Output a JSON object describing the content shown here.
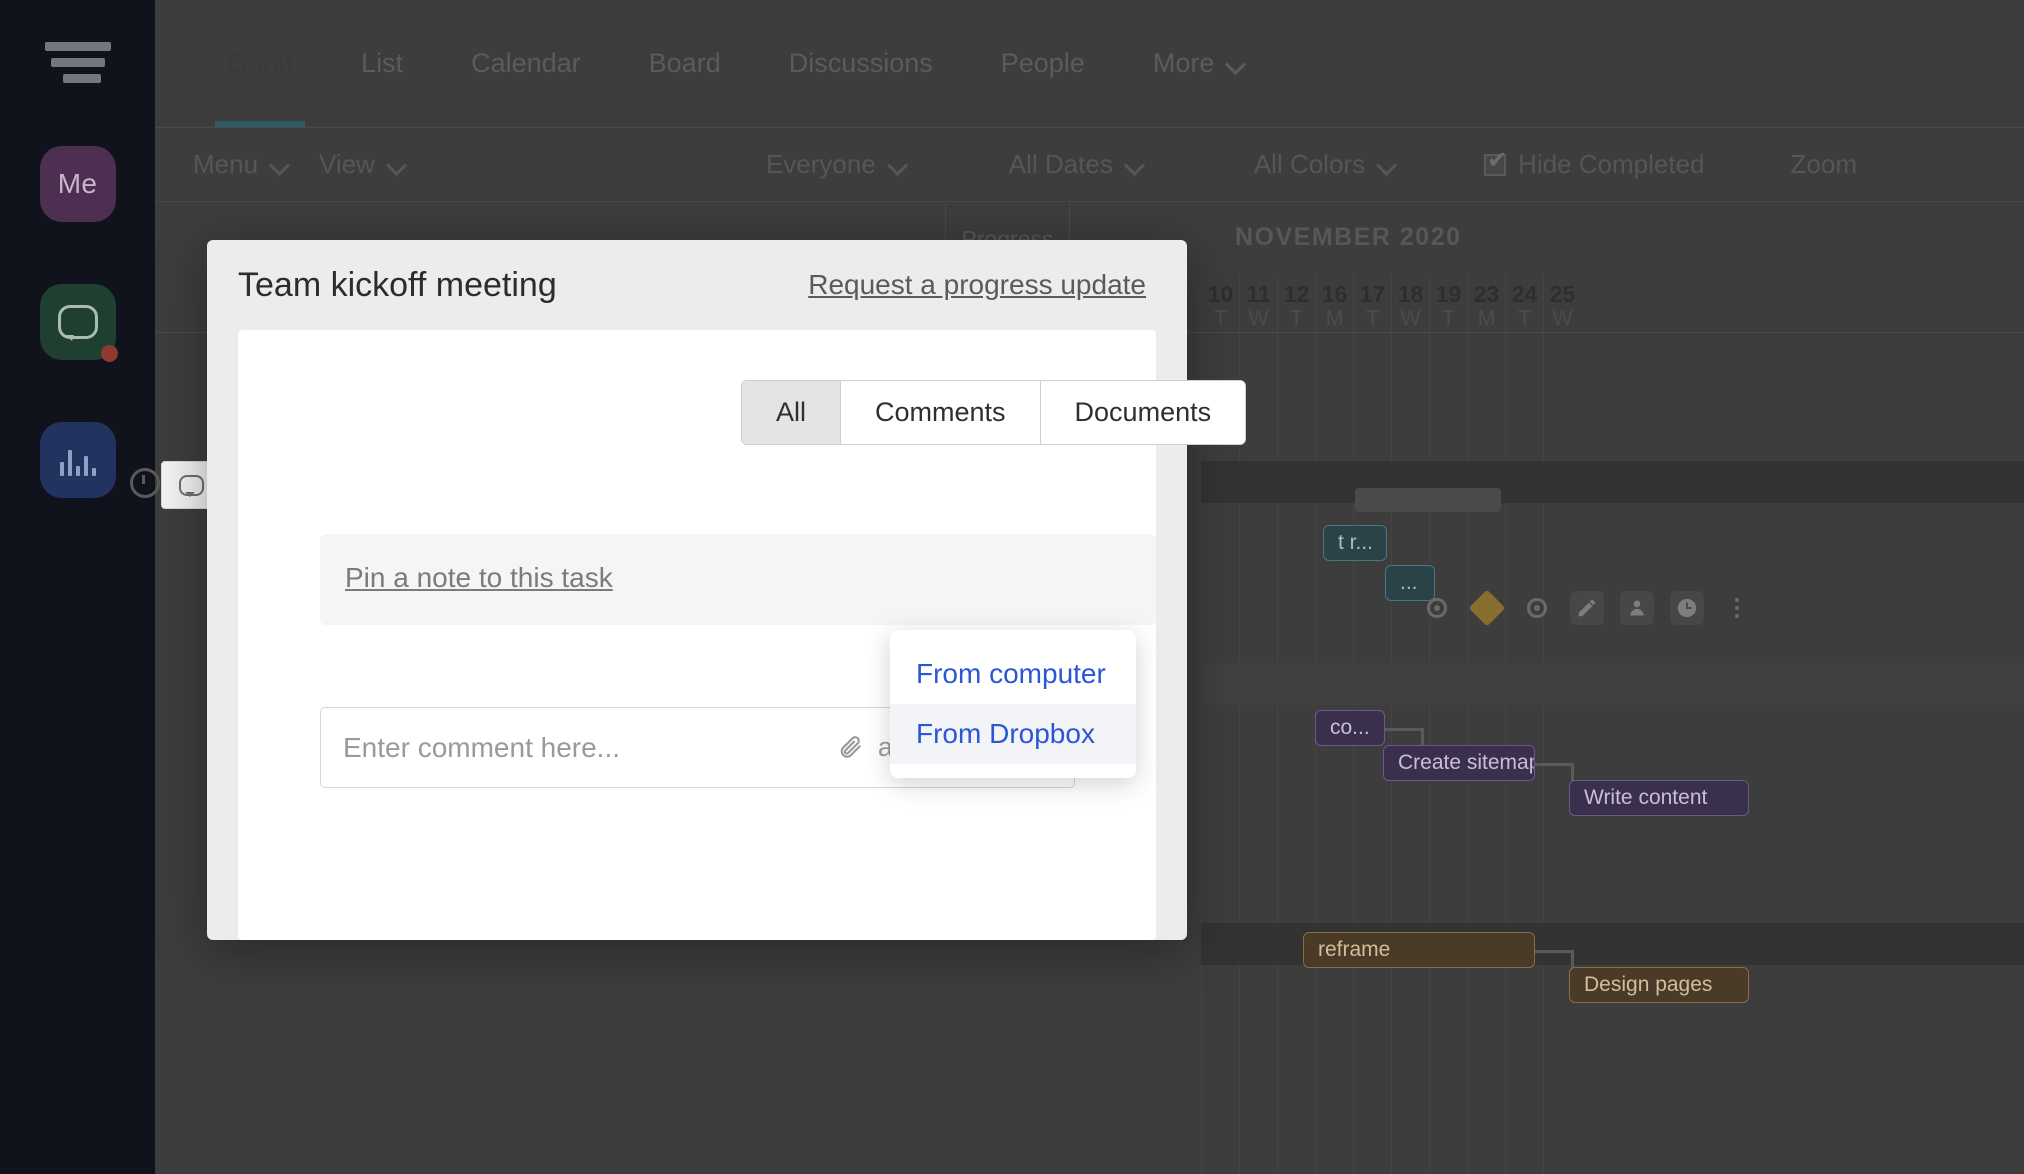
{
  "rail": {
    "logo": "logo-icon",
    "buttons": [
      {
        "name": "me-avatar",
        "label": "Me"
      },
      {
        "name": "chat-button",
        "label": "",
        "badge": true
      },
      {
        "name": "stats-button",
        "label": ""
      }
    ]
  },
  "tabs": [
    {
      "label": "Gantt",
      "active": true
    },
    {
      "label": "List",
      "active": false
    },
    {
      "label": "Calendar",
      "active": false
    },
    {
      "label": "Board",
      "active": false
    },
    {
      "label": "Discussions",
      "active": false
    },
    {
      "label": "People",
      "active": false
    },
    {
      "label": "More",
      "active": false,
      "caret": true
    }
  ],
  "toolbar": {
    "menu": "Menu",
    "view": "View",
    "everyone": "Everyone",
    "all_dates": "All Dates",
    "all_colors": "All Colors",
    "hide_completed": "Hide Completed",
    "hide_completed_checked": true,
    "zoom": "Zoom"
  },
  "gantt": {
    "progress_header": "Progress",
    "month": "NOVEMBER 2020",
    "days": [
      {
        "n": "10",
        "w": "T"
      },
      {
        "n": "11",
        "w": "W"
      },
      {
        "n": "12",
        "w": "T"
      },
      {
        "n": "16",
        "w": "M"
      },
      {
        "n": "17",
        "w": "T"
      },
      {
        "n": "18",
        "w": "W"
      },
      {
        "n": "19",
        "w": "T"
      },
      {
        "n": "23",
        "w": "M"
      },
      {
        "n": "24",
        "w": "T"
      },
      {
        "n": "25",
        "w": "W"
      }
    ],
    "bars": [
      {
        "label": "t r...",
        "color": "teal"
      },
      {
        "label": "...",
        "color": "teal"
      },
      {
        "label": "co...",
        "color": "purple"
      },
      {
        "label": "Create sitemap",
        "color": "purple"
      },
      {
        "label": "Write content",
        "color": "purple"
      },
      {
        "label": "reframe",
        "color": "brown"
      },
      {
        "label": "Design pages",
        "color": "brown"
      }
    ],
    "row_icons": [
      "progress-dot-icon",
      "milestone-diamond-icon",
      "progress-dot-icon",
      "edit-pencil-icon",
      "assignee-person-icon",
      "time-clock-icon",
      "more-kebab-icon"
    ]
  },
  "modal": {
    "title": "Team kickoff meeting",
    "request_update_link": "Request a progress update",
    "segments": [
      {
        "label": "All",
        "active": true
      },
      {
        "label": "Comments",
        "active": false
      },
      {
        "label": "Documents",
        "active": false
      }
    ],
    "pin_note_link": "Pin a note to this task",
    "comment_placeholder": "Enter comment here...",
    "add_document_label": "add document",
    "add_document_icon": "paperclip-icon"
  },
  "dropdown": {
    "items": [
      {
        "label": "From computer",
        "hover": false
      },
      {
        "label": "From Dropbox",
        "hover": true
      }
    ],
    "color": "#2b56d6"
  },
  "colors": {
    "rail_bg": "#11131c",
    "app_bg": "#3d3d3d",
    "accent_tab": "#2c5b64",
    "modal_bg": "#ececec",
    "link_blue": "#2b56d6"
  }
}
